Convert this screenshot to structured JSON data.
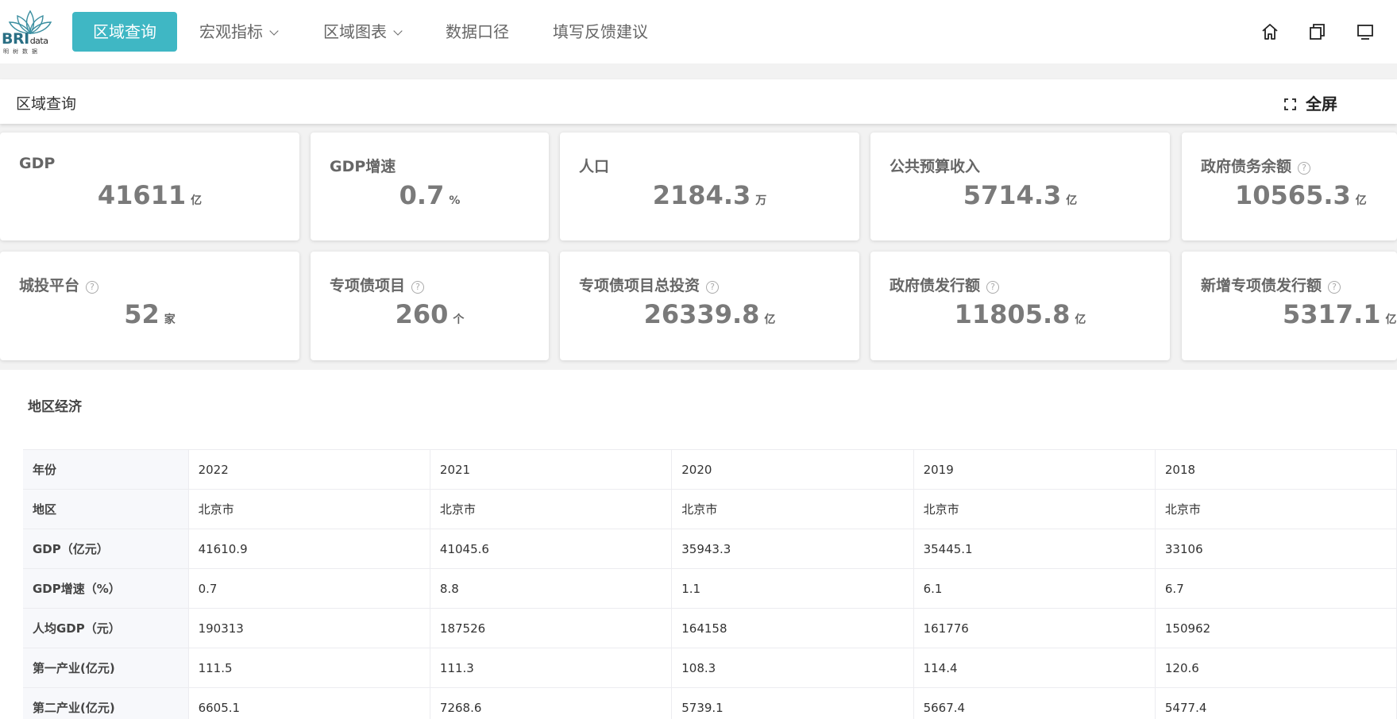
{
  "brand": {
    "logo_text": "BRI",
    "logo_small": "data",
    "logo_sub": "明树数据"
  },
  "nav": {
    "items": [
      {
        "label": "区域查询"
      },
      {
        "label": "宏观指标"
      },
      {
        "label": "区域图表"
      },
      {
        "label": "数据口径"
      },
      {
        "label": "填写反馈建议"
      }
    ],
    "icons": [
      "home-icon",
      "copy-icon",
      "monitor-icon"
    ]
  },
  "panel": {
    "title": "区域查询",
    "fullscreen_label": "全屏"
  },
  "cards": [
    {
      "label": "GDP",
      "value": "41611",
      "unit": "亿"
    },
    {
      "label": "GDP增速",
      "value": "0.7",
      "unit": "%"
    },
    {
      "label": "人口",
      "value": "2184.3",
      "unit": "万"
    },
    {
      "label": "公共预算收入",
      "value": "5714.3",
      "unit": "亿"
    },
    {
      "label": "政府债务余额",
      "value": "10565.3",
      "unit": "亿"
    },
    {
      "label": "城投平台",
      "value": "52",
      "unit": "家"
    },
    {
      "label": "专项债项目",
      "value": "260",
      "unit": "个"
    },
    {
      "label": "专项债项目总投资",
      "value": "26339.8",
      "unit": "亿"
    },
    {
      "label": "政府债发行额",
      "value": "11805.8",
      "unit": "亿"
    },
    {
      "label": "新增专项债发行额",
      "value": "5317.1",
      "unit": "亿"
    }
  ],
  "section": {
    "title": "地区经济",
    "rows": [
      {
        "header": "年份",
        "values": [
          "2022",
          "2021",
          "2020",
          "2019",
          "2018"
        ]
      },
      {
        "header": "地区",
        "values": [
          "北京市",
          "北京市",
          "北京市",
          "北京市",
          "北京市"
        ]
      },
      {
        "header": "GDP（亿元）",
        "values": [
          "41610.9",
          "41045.6",
          "35943.3",
          "35445.1",
          "33106"
        ]
      },
      {
        "header": "GDP增速（%）",
        "values": [
          "0.7",
          "8.8",
          "1.1",
          "6.1",
          "6.7"
        ]
      },
      {
        "header": "人均GDP（元）",
        "values": [
          "190313",
          "187526",
          "164158",
          "161776",
          "150962"
        ]
      },
      {
        "header": "第一产业(亿元)",
        "values": [
          "111.5",
          "111.3",
          "108.3",
          "114.4",
          "120.6"
        ]
      },
      {
        "header": "第二产业(亿元)",
        "values": [
          "6605.1",
          "7268.6",
          "5739.1",
          "5667.4",
          "5477.4"
        ]
      }
    ]
  },
  "colors": {
    "accent": "#3fb7c4",
    "brand": "#2a6f84"
  }
}
